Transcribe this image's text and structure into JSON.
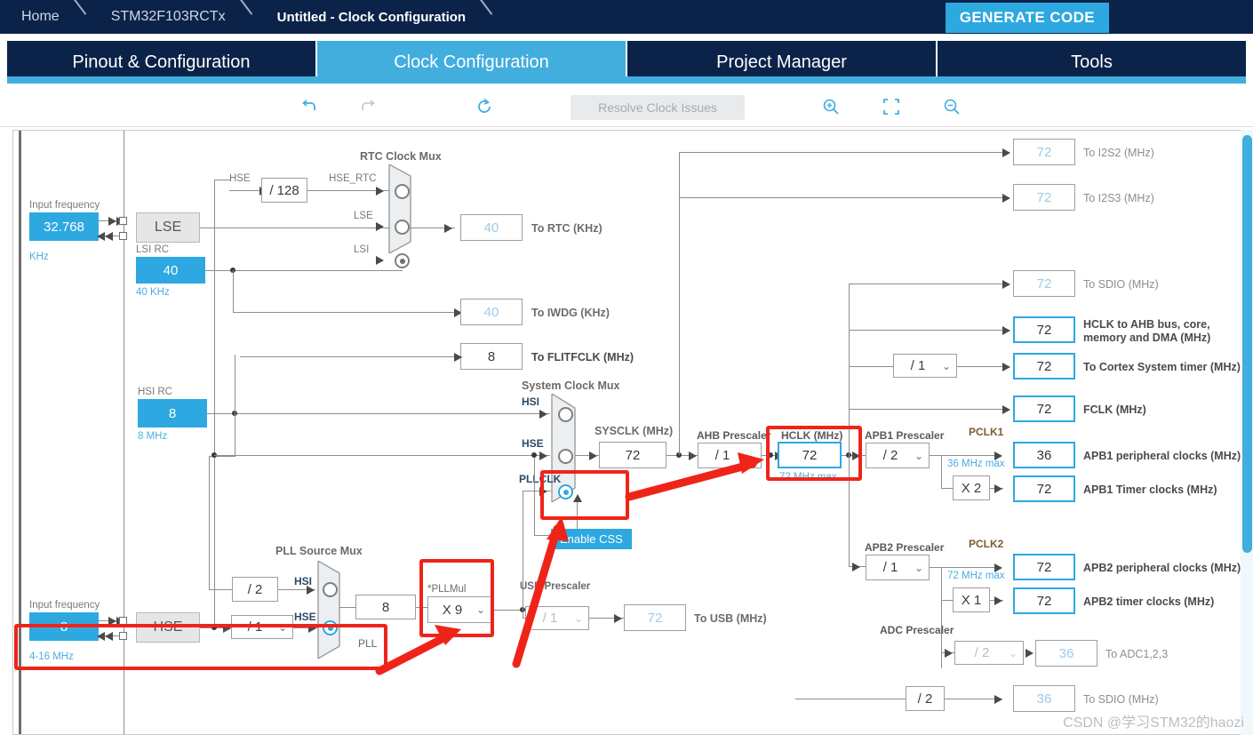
{
  "breadcrumb": {
    "items": [
      {
        "label": "Home",
        "active": false
      },
      {
        "label": "STM32F103RCTx",
        "active": false
      },
      {
        "label": "Untitled - Clock Configuration",
        "active": true
      }
    ]
  },
  "header": {
    "generate_code_label": "GENERATE CODE",
    "accent_color": "#2ea8e0",
    "navy_color": "#0b2349"
  },
  "tabs": [
    {
      "label": "Pinout & Configuration",
      "selected": false
    },
    {
      "label": "Clock Configuration",
      "selected": true
    },
    {
      "label": "Project Manager",
      "selected": false
    },
    {
      "label": "Tools",
      "selected": false
    }
  ],
  "toolbar": {
    "undo_icon": "undo-icon",
    "redo_icon": "redo-icon",
    "reset_icon": "reset-icon",
    "resolve_label": "Resolve Clock Issues",
    "zoom_in_icon": "zoom-in-icon",
    "fit_icon": "fit-to-screen-icon",
    "zoom_out_icon": "zoom-out-icon"
  },
  "diagram": {
    "lse": {
      "input_frequency_label": "Input frequency",
      "value": "32.768",
      "unit_label": "KHz",
      "osc_label": "LSE"
    },
    "lsi": {
      "title": "LSI RC",
      "value": "40",
      "range_label": "40 KHz"
    },
    "hsi": {
      "title": "HSI RC",
      "value": "8",
      "range_label": "8 MHz"
    },
    "hse": {
      "input_frequency_label": "Input frequency",
      "value": "8",
      "range_label": "4-16 MHz",
      "osc_label": "HSE",
      "prescaler_value": "/ 1"
    },
    "hse_div128": {
      "input_label": "HSE",
      "value": "/ 128",
      "output_label": "HSE_RTC"
    },
    "rtc_mux": {
      "title": "RTC Clock Mux",
      "inputs": [
        "HSE_RTC",
        "LSE",
        "LSI"
      ],
      "selected_index": 2
    },
    "outputs_left": [
      {
        "value": "40",
        "label": "To RTC (KHz)",
        "active": false
      },
      {
        "value": "40",
        "label": "To IWDG (KHz)",
        "active": false
      },
      {
        "value": "8",
        "label": "To FLITFCLK (MHz)",
        "active": false
      }
    ],
    "system_clock_mux": {
      "title": "System Clock Mux",
      "inputs": [
        "HSI",
        "HSE",
        "PLLCLK"
      ],
      "selected_index": 2
    },
    "enable_css_label": "Enable CSS",
    "sysclk": {
      "title": "SYSCLK (MHz)",
      "value": "72"
    },
    "ahb_prescaler": {
      "title": "AHB Prescaler",
      "value": "/ 1"
    },
    "hclk": {
      "title": "HCLK (MHz)",
      "value": "72",
      "max_label": "72 MHz max"
    },
    "apb1_prescaler": {
      "title": "APB1 Prescaler",
      "value": "/ 2",
      "bus_label": "PCLK1",
      "max_label": "36 MHz max",
      "multiplier": "X 2"
    },
    "apb2_prescaler": {
      "title": "APB2 Prescaler",
      "value": "/ 1",
      "bus_label": "PCLK2",
      "max_label": "72 MHz max",
      "multiplier": "X 1"
    },
    "adc_prescaler": {
      "title": "ADC Prescaler",
      "value": "/ 2"
    },
    "sdio_divider": {
      "value": "/ 2"
    },
    "cortex_prescaler": {
      "value": "/ 1"
    },
    "usb_prescaler": {
      "title": "USB Prescaler",
      "value": "/ 1",
      "output_value": "72",
      "output_label": "To USB (MHz)"
    },
    "pll_source_mux": {
      "title": "PLL Source Mux",
      "inputs": [
        "HSI",
        "HSE"
      ],
      "selected_index": 1,
      "hsi_divider": "/ 2",
      "pll_label": "PLL"
    },
    "pll": {
      "input_value": "8",
      "mul_title": "*PLLMul",
      "mul_value": "X 9"
    },
    "outputs_right": [
      {
        "value": "72",
        "label": "To I2S2 (MHz)",
        "active": false
      },
      {
        "value": "72",
        "label": "To I2S3 (MHz)",
        "active": false
      },
      {
        "value": "72",
        "label": "To SDIO (MHz)",
        "active": false
      },
      {
        "value": "72",
        "label": "HCLK to AHB bus, core,",
        "label2": "memory and DMA (MHz)",
        "active": true
      },
      {
        "value": "72",
        "label": "To Cortex System timer (MHz)",
        "active": true
      },
      {
        "value": "72",
        "label": "FCLK (MHz)",
        "active": true
      }
    ],
    "apb1_outputs": [
      {
        "value": "36",
        "label": "APB1 peripheral clocks (MHz)",
        "active": true
      },
      {
        "value": "72",
        "label": "APB1 Timer clocks (MHz)",
        "active": true
      }
    ],
    "apb2_outputs": [
      {
        "value": "72",
        "label": "APB2 peripheral clocks (MHz)",
        "active": true
      },
      {
        "value": "72",
        "label": "APB2 timer clocks (MHz)",
        "active": true
      }
    ],
    "adc_output": {
      "value": "36",
      "label": "To ADC1,2,3",
      "active": false
    },
    "sdio_output": {
      "value": "36",
      "label": "To SDIO (MHz)",
      "active": false
    }
  },
  "annotation": {
    "color": "#ef2419"
  },
  "watermark": "CSDN @学习STM32的haozi"
}
